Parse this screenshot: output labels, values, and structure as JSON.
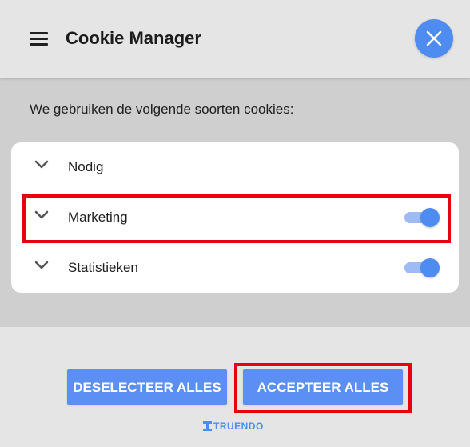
{
  "header": {
    "title": "Cookie Manager"
  },
  "intro_text": "We gebruiken de volgende soorten cookies:",
  "categories": [
    {
      "label": "Nodig",
      "has_toggle": false
    },
    {
      "label": "Marketing",
      "has_toggle": true,
      "enabled": true
    },
    {
      "label": "Statistieken",
      "has_toggle": true,
      "enabled": true
    }
  ],
  "footer": {
    "deselect_label": "DESELECTEER ALLES",
    "accept_label": "ACCEPTEER ALLES",
    "brand": "TRUENDO"
  },
  "colors": {
    "accent": "#4e8cf2",
    "button": "#5b8ff3",
    "highlight": "#e8000b",
    "header_bg": "#e5e5e5",
    "overlay_bg": "#cfcfcf"
  },
  "icons": {
    "menu": "hamburger-menu-icon",
    "close": "close-icon",
    "expand": "chevron-down-icon"
  }
}
